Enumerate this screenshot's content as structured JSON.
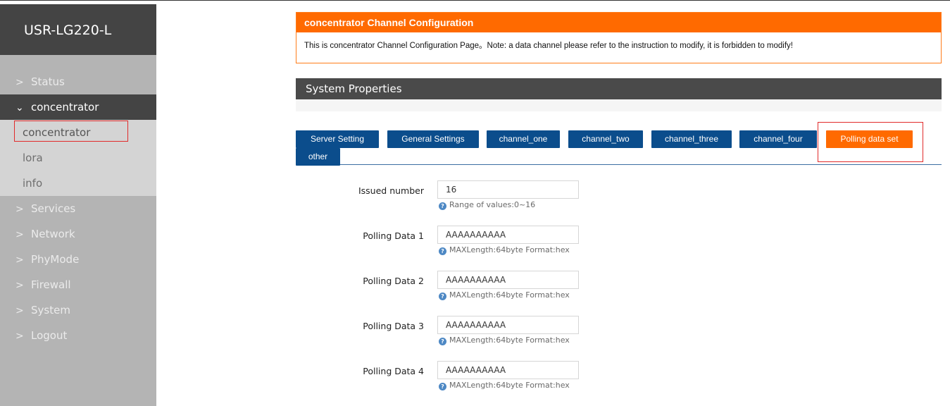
{
  "brand": "USR-LG220-L",
  "nav": {
    "status": "Status",
    "concentrator": "concentrator",
    "sub": {
      "concentrator": "concentrator",
      "lora": "lora",
      "info": "info"
    },
    "services": "Services",
    "network": "Network",
    "phymode": "PhyMode",
    "firewall": "Firewall",
    "system": "System",
    "logout": "Logout"
  },
  "header": {
    "title": "concentrator Channel Configuration",
    "description": "This is concentrator Channel Configuration Page。Note: a data channel please refer to the instruction to modify, it is forbidden to modify!"
  },
  "section": {
    "title": "System Properties"
  },
  "tabs": {
    "server_setting": "Server Setting",
    "general_settings": "General Settings",
    "channel_one": "channel_one",
    "channel_two": "channel_two",
    "channel_three": "channel_three",
    "channel_four": "channel_four",
    "polling_data_set": "Polling data set",
    "other": "other"
  },
  "form": {
    "issued_number": {
      "label": "Issued number",
      "value": "16",
      "hint": "Range of values:0~16"
    },
    "polling_1": {
      "label": "Polling Data 1",
      "value": "AAAAAAAAAA",
      "hint": "MAXLength:64byte Format:hex"
    },
    "polling_2": {
      "label": "Polling Data 2",
      "value": "AAAAAAAAAA",
      "hint": "MAXLength:64byte Format:hex"
    },
    "polling_3": {
      "label": "Polling Data 3",
      "value": "AAAAAAAAAA",
      "hint": "MAXLength:64byte Format:hex"
    },
    "polling_4": {
      "label": "Polling Data 4",
      "value": "AAAAAAAAAA",
      "hint": "MAXLength:64byte Format:hex"
    }
  },
  "colors": {
    "accent_orange": "#ff6a00",
    "tab_blue": "#0b4d8c",
    "sidebar_dark": "#444444",
    "sidebar_gray": "#b4b4b4",
    "highlight_red": "#e12b2b"
  }
}
